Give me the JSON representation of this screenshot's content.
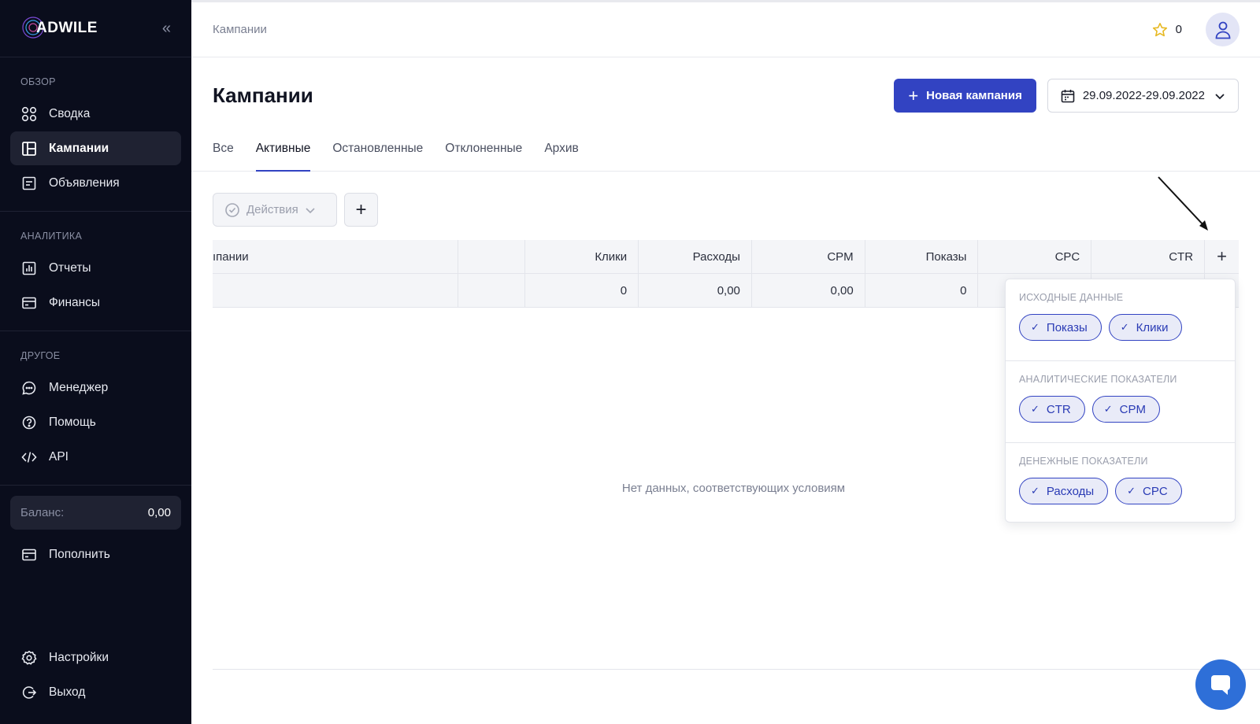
{
  "sidebar": {
    "logo": "ADWILE",
    "sections": [
      {
        "title": "ОБЗОР",
        "items": [
          "Сводка",
          "Кампании",
          "Объявления"
        ]
      },
      {
        "title": "АНАЛИТИКА",
        "items": [
          "Отчеты",
          "Финансы"
        ]
      },
      {
        "title": "ДРУГОЕ",
        "items": [
          "Менеджер",
          "Помощь",
          "API"
        ]
      }
    ],
    "balance_label": "Баланс:",
    "balance_value": "0,00",
    "topup": "Пополнить",
    "settings": "Настройки",
    "logout": "Выход"
  },
  "topbar": {
    "breadcrumb": "Кампании",
    "favorites_count": "0"
  },
  "header": {
    "title": "Кампании",
    "new_campaign": "Новая кампания",
    "date_range": "29.09.2022-29.09.2022"
  },
  "tabs": [
    "Все",
    "Активные",
    "Остановленные",
    "Отклоненные",
    "Архив"
  ],
  "toolbar": {
    "actions": "Действия",
    "add": "+"
  },
  "table": {
    "headers": [
      "ıпании",
      "",
      "Клики",
      "Расходы",
      "CPM",
      "Показы",
      "CPC",
      "CTR"
    ],
    "totals": [
      "",
      "",
      "0",
      "0,00",
      "0,00",
      "0",
      "",
      ""
    ],
    "empty": "Нет данных, соответствующих условиям"
  },
  "column_picker": {
    "groups": [
      {
        "title": "ИСХОДНЫЕ ДАННЫЕ",
        "chips": [
          "Показы",
          "Клики"
        ]
      },
      {
        "title": "АНАЛИТИЧЕСКИЕ ПОКАЗАТЕЛИ",
        "chips": [
          "CTR",
          "CPM"
        ]
      },
      {
        "title": "ДЕНЕЖНЫЕ ПОКАЗАТЕЛИ",
        "chips": [
          "Расходы",
          "CPC"
        ]
      }
    ]
  },
  "colors": {
    "sidebar_bg": "#0a0d1c",
    "accent": "#3243c2",
    "chat": "#2e6fd8"
  }
}
